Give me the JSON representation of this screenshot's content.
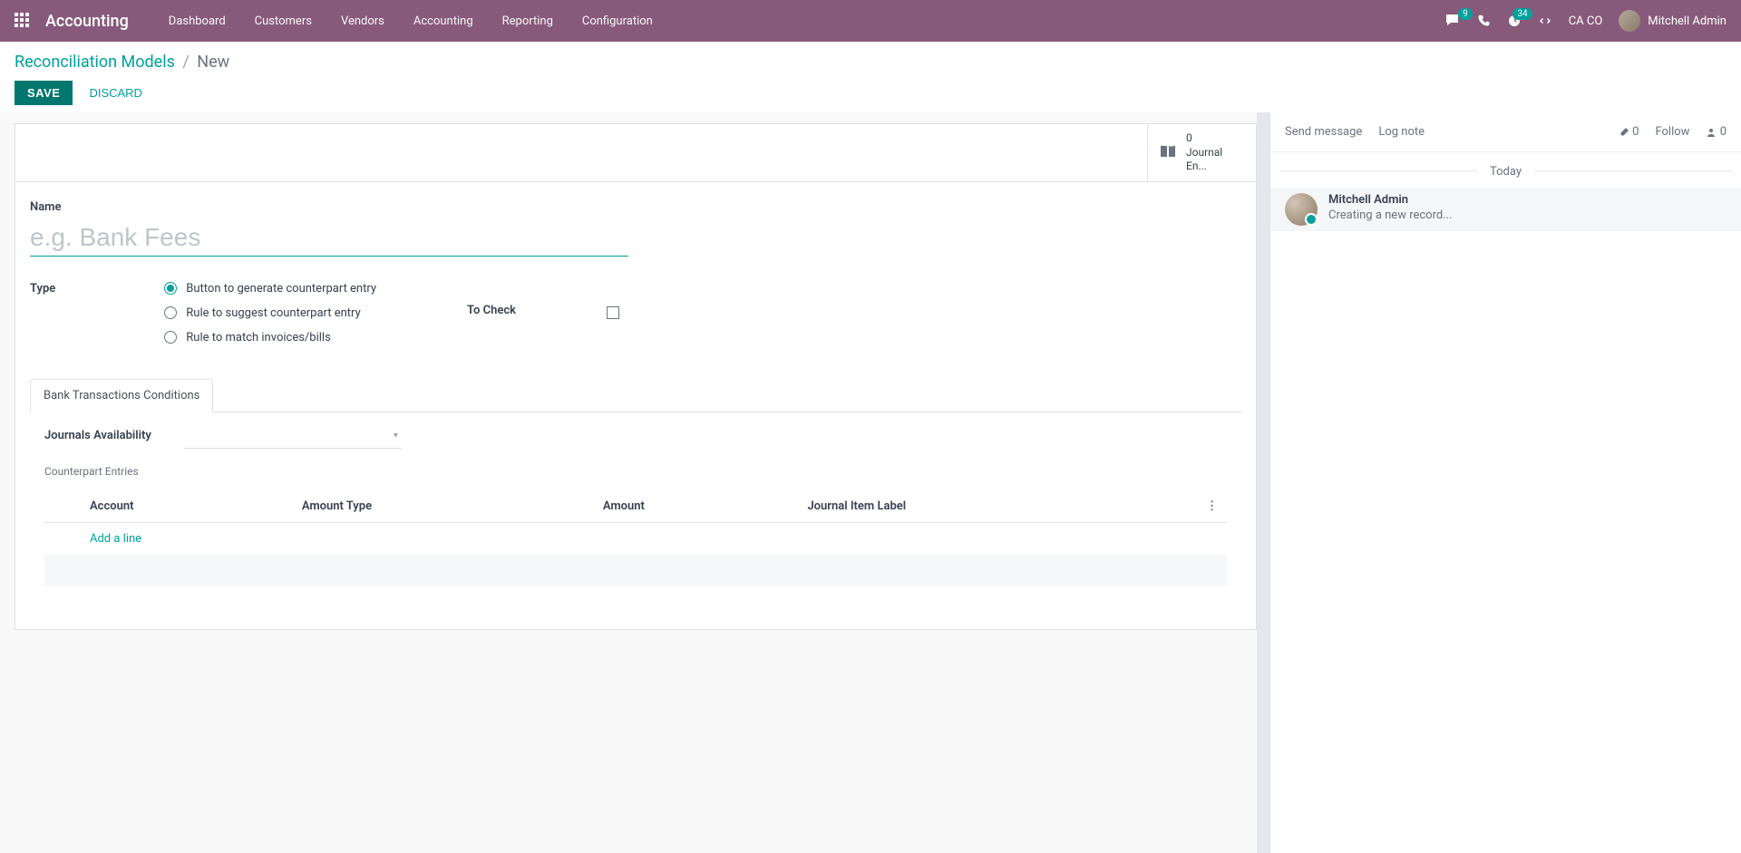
{
  "nav": {
    "brand": "Accounting",
    "items": [
      "Dashboard",
      "Customers",
      "Vendors",
      "Accounting",
      "Reporting",
      "Configuration"
    ],
    "messages_count": "9",
    "activities_count": "34",
    "company": "CA CO",
    "user": "Mitchell Admin"
  },
  "breadcrumb": {
    "parent": "Reconciliation Models",
    "current": "New"
  },
  "actions": {
    "save": "SAVE",
    "discard": "DISCARD"
  },
  "stat_button": {
    "count": "0",
    "label": "Journal En..."
  },
  "form": {
    "name_label": "Name",
    "name_placeholder": "e.g. Bank Fees",
    "type_label": "Type",
    "type_options": [
      "Button to generate counterpart entry",
      "Rule to suggest counterpart entry",
      "Rule to match invoices/bills"
    ],
    "to_check_label": "To Check",
    "tab_label": "Bank Transactions Conditions",
    "journals_label": "Journals Availability",
    "counterpart_label": "Counterpart Entries",
    "table_headers": [
      "Account",
      "Amount Type",
      "Amount",
      "Journal Item Label"
    ],
    "add_line": "Add a line"
  },
  "chatter": {
    "send_message": "Send message",
    "log_note": "Log note",
    "attach_count": "0",
    "follow": "Follow",
    "follower_count": "0",
    "divider": "Today",
    "message_author": "Mitchell Admin",
    "message_text": "Creating a new record..."
  }
}
